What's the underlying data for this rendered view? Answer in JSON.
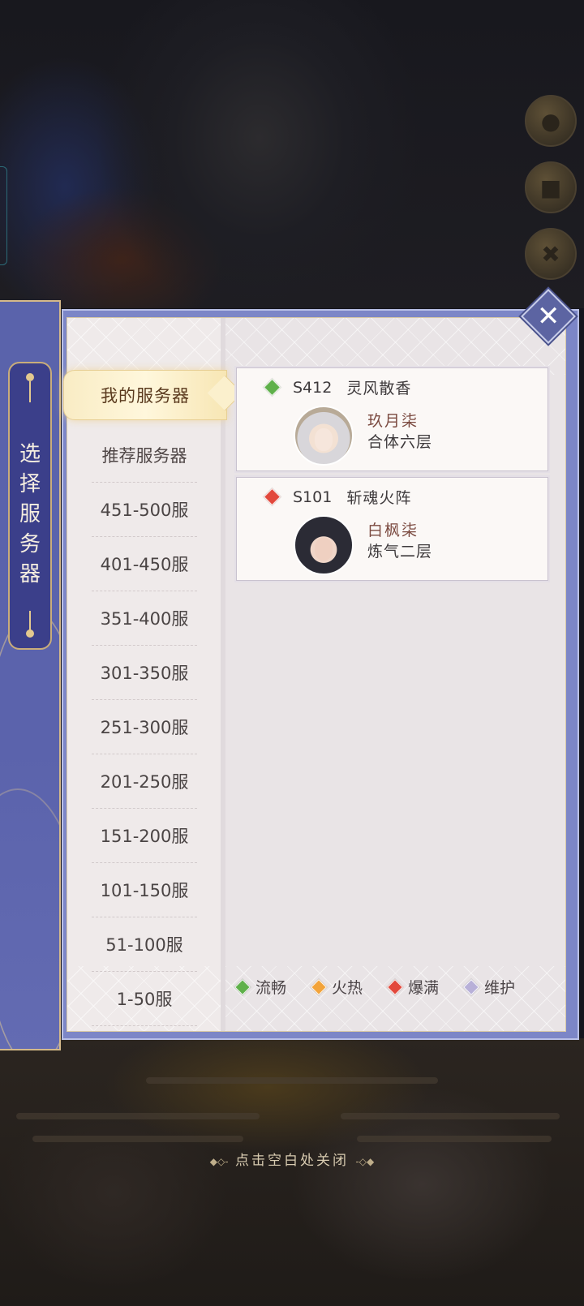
{
  "background": {
    "close_hint": "点击空白处关闭",
    "side_buttons": [
      "avatar-icon",
      "menu-icon",
      "tools-icon"
    ]
  },
  "banner": {
    "title_chars": [
      "选",
      "择",
      "服",
      "务",
      "器"
    ]
  },
  "categories": {
    "selected": "我的服务器",
    "items": [
      "推荐服务器",
      "451-500服",
      "401-450服",
      "351-400服",
      "301-350服",
      "251-300服",
      "201-250服",
      "151-200服",
      "101-150服",
      "51-100服",
      "1-50服"
    ]
  },
  "servers": [
    {
      "id": "S412",
      "name": "灵风散香",
      "status": "流畅",
      "status_color": "#5fb04a",
      "character": "玖月柒",
      "level": "合体六层"
    },
    {
      "id": "S101",
      "name": "斩魂火阵",
      "status": "爆满",
      "status_color": "#e2483c",
      "character": "白枫柒",
      "level": "炼气二层"
    }
  ],
  "legend": [
    {
      "label": "流畅",
      "color": "#5fb04a"
    },
    {
      "label": "火热",
      "color": "#f2a33a"
    },
    {
      "label": "爆满",
      "color": "#e2483c"
    },
    {
      "label": "维护",
      "color": "#b8b0d8"
    }
  ]
}
